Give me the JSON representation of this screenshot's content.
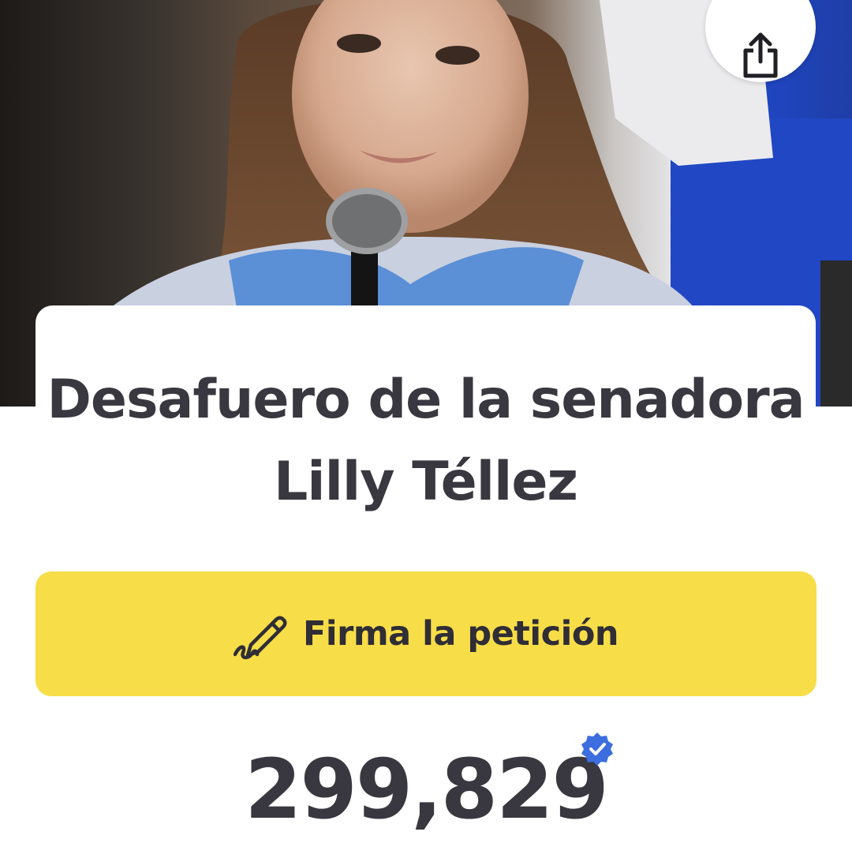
{
  "petition": {
    "title": "Desafuero de la senadora Lilly Téllez",
    "sign_label": "Firma la petición",
    "signature_count": "299,829",
    "verified": true
  },
  "icons": {
    "share": "share-icon",
    "pen": "pen-icon",
    "verified": "verified-badge-icon"
  },
  "colors": {
    "sign_button": "#f7dd48",
    "title_text": "#39373f",
    "verified_badge": "#3c6ee0"
  }
}
